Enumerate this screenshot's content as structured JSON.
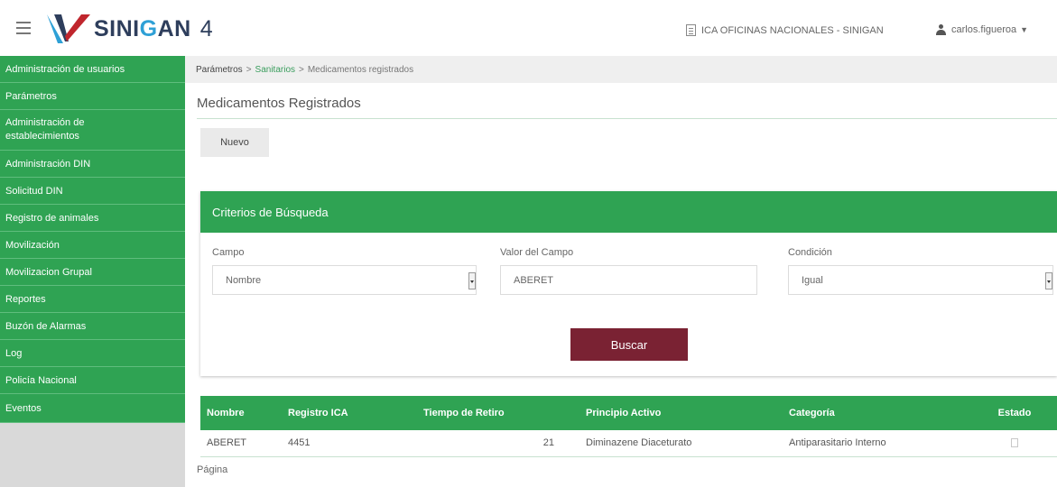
{
  "header": {
    "logo_text_a": "SINI",
    "logo_text_b": "G",
    "logo_text_c": "AN",
    "version": "4",
    "office": "ICA OFICINAS NACIONALES - SINIGAN",
    "user": "carlos.figueroa"
  },
  "sidebar": {
    "items": [
      {
        "label": "Administración de usuarios"
      },
      {
        "label": "Parámetros"
      },
      {
        "label": "Administración de establecimientos"
      },
      {
        "label": "Administración DIN"
      },
      {
        "label": "Solicitud DIN"
      },
      {
        "label": "Registro de animales"
      },
      {
        "label": "Movilización"
      },
      {
        "label": "Movilizacion Grupal"
      },
      {
        "label": "Reportes"
      },
      {
        "label": "Buzón de Alarmas"
      },
      {
        "label": "Log"
      },
      {
        "label": "Policía Nacional"
      },
      {
        "label": "Eventos"
      }
    ]
  },
  "breadcrumb": {
    "first": "Parámetros",
    "second": "Sanitarios",
    "third": "Medicamentos registrados",
    "separator": ">"
  },
  "page": {
    "title": "Medicamentos Registrados",
    "new_button": "Nuevo"
  },
  "criteria": {
    "title": "Criterios de Búsqueda",
    "campo_label": "Campo",
    "campo_value": "Nombre",
    "valor_label": "Valor del Campo",
    "valor_value": "ABERET",
    "condicion_label": "Condición",
    "condicion_value": "Igual",
    "search_button": "Buscar"
  },
  "results": {
    "columns": [
      "Nombre",
      "Registro ICA",
      "Tiempo de Retiro",
      "Principio Activo",
      "Categoría",
      "Estado"
    ],
    "rows": [
      {
        "nombre": "ABERET",
        "registro": "4451",
        "tiempo": "21",
        "principio": "Diminazene Diaceturato",
        "categoria": "Antiparasitario Interno"
      }
    ],
    "pagination_label": "Página"
  },
  "colors": {
    "green": "#2fa353",
    "maroon": "#7a2233",
    "logo_navy": "#2e3e5c",
    "logo_blue": "#2ea0d6"
  }
}
